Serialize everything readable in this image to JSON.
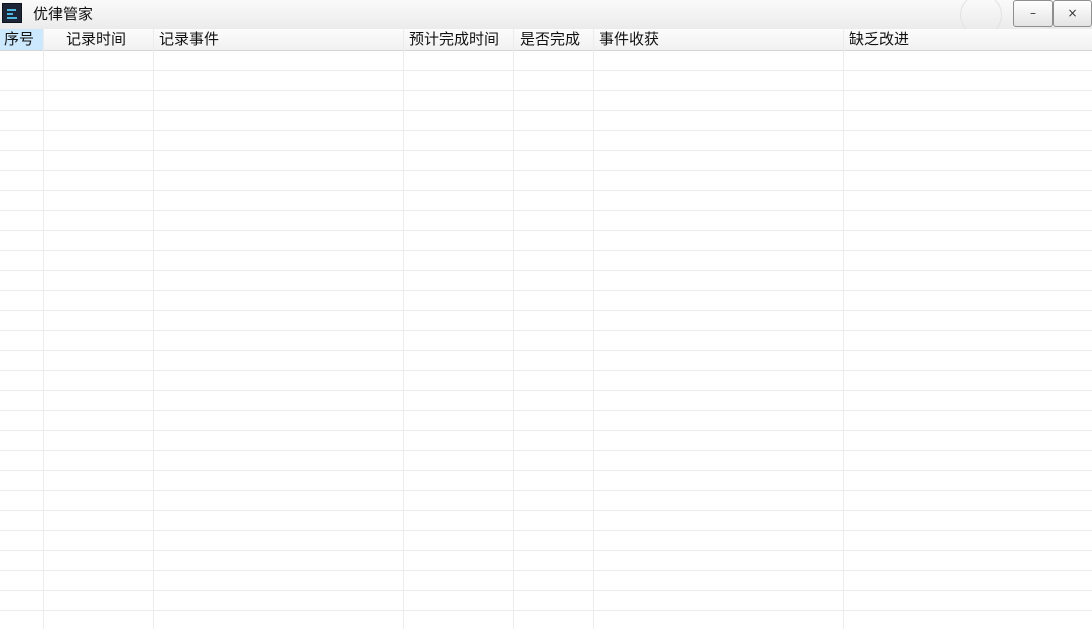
{
  "window": {
    "title": "优律管家",
    "minimize_label": "–",
    "close_label": "×",
    "icon": "app-logo-icon"
  },
  "table": {
    "columns": [
      {
        "label": "序号"
      },
      {
        "label": "记录时间"
      },
      {
        "label": "记录事件"
      },
      {
        "label": "预计完成时间"
      },
      {
        "label": "是否完成"
      },
      {
        "label": "事件收获"
      },
      {
        "label": "缺乏改进"
      }
    ],
    "selected_column": "序号",
    "rows": []
  },
  "colors": {
    "selected_header": "#cce8ff",
    "grid_line": "#ececec",
    "icon_bg": "#1c2636",
    "icon_accent": "#4fb8e0"
  }
}
